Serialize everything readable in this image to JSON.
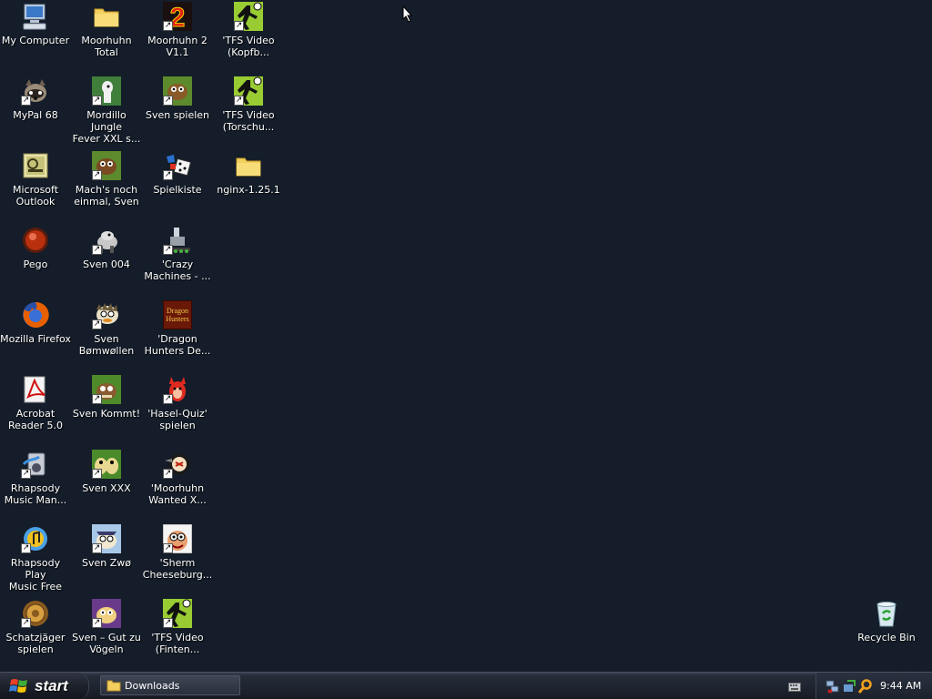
{
  "desktop_icons": [
    {
      "label": "My Computer",
      "icon": "my-computer-icon"
    },
    {
      "label": "MyPal 68",
      "icon": "mypal-icon"
    },
    {
      "label": "Microsoft\nOutlook",
      "icon": "outlook-icon"
    },
    {
      "label": "Pego",
      "icon": "pego-icon"
    },
    {
      "label": "Mozilla Firefox",
      "icon": "firefox-icon"
    },
    {
      "label": "Acrobat\nReader 5.0",
      "icon": "acrobat-icon"
    },
    {
      "label": "Rhapsody\nMusic Man...",
      "icon": "rhapsody-icon"
    },
    {
      "label": "Rhapsody Play\nMusic Free",
      "icon": "rhapsody-play-icon"
    },
    {
      "label": "Schatzjäger\nspielen",
      "icon": "schatzjaeger-icon"
    },
    {
      "label": "Moorhuhn\nTotal",
      "icon": "folder-icon"
    },
    {
      "label": "Mordillo Jungle\nFever XXL s...",
      "icon": "mordillo-icon"
    },
    {
      "label": "Mach's noch\neinmal, Sven",
      "icon": "sven-icon"
    },
    {
      "label": "Sven 004",
      "icon": "sven-004-icon"
    },
    {
      "label": "Sven\nBømwøllen",
      "icon": "sven-bomwollen-icon"
    },
    {
      "label": "Sven Kommt!",
      "icon": "sven-kommt-icon"
    },
    {
      "label": "Sven XXX",
      "icon": "sven-xxx-icon"
    },
    {
      "label": "Sven Zwø",
      "icon": "sven-zwo-icon"
    },
    {
      "label": "Sven – Gut zu\nVögeln",
      "icon": "sven-gut-icon"
    },
    {
      "label": "Moorhuhn 2\nV1.1",
      "icon": "moorhuhn-2-icon"
    },
    {
      "label": "Sven spielen",
      "icon": "sven-spielen-icon"
    },
    {
      "label": "Spielkiste",
      "icon": "spielkiste-icon"
    },
    {
      "label": "'Crazy\nMachines - ...",
      "icon": "crazy-machines-icon"
    },
    {
      "label": "'Dragon\nHunters De...",
      "icon": "dragon-hunters-icon"
    },
    {
      "label": "'Hasel-Quiz'\nspielen",
      "icon": "hasel-quiz-icon"
    },
    {
      "label": "'Moorhuhn\nWanted X...",
      "icon": "moorhuhn-wanted-icon"
    },
    {
      "label": "'Sherm\nCheeseburg...",
      "icon": "sherm-icon"
    },
    {
      "label": "'TFS Video\n(Finten...",
      "icon": "tfs-video-icon"
    },
    {
      "label": "'TFS Video\n(Kopfb...",
      "icon": "tfs-video-icon"
    },
    {
      "label": "'TFS Video\n(Torschu...",
      "icon": "tfs-video-icon"
    },
    {
      "label": "nginx-1.25.1",
      "icon": "folder-icon"
    },
    {
      "label": "Recycle Bin",
      "icon": "recycle-bin-icon"
    }
  ],
  "dragon_icon_text": "Dragon\nHunters",
  "taskbar": {
    "start_label": "start",
    "task_label": "Downloads",
    "clock": "9:44 AM"
  },
  "colors": {
    "desktop_bg": "#141d29",
    "taskbar_bg": "#1f2530",
    "folder": "#f3cf5e",
    "tfs_green": "#99cc33",
    "firefox_orange": "#e66000",
    "start_flag_red": "#e8412a",
    "start_flag_green": "#3fae3a",
    "start_flag_blue": "#3a7fd6",
    "start_flag_yellow": "#f5c400"
  }
}
